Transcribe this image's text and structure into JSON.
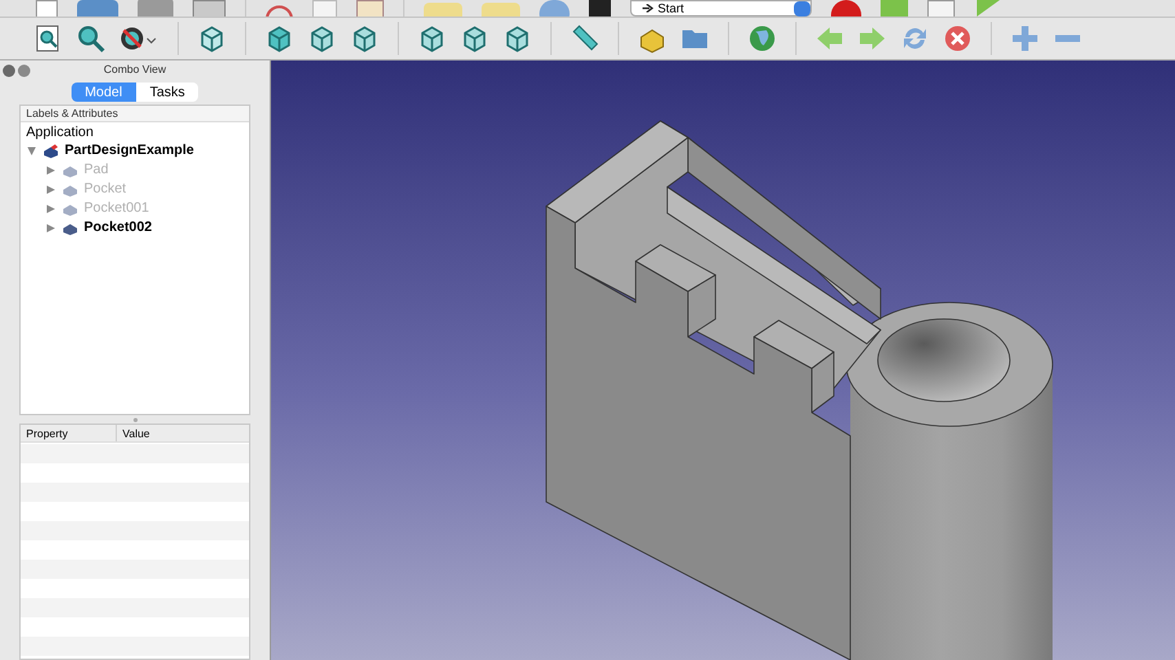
{
  "toolbar": {
    "workbench": "Start"
  },
  "combo_view": {
    "title": "Combo View",
    "tabs": [
      {
        "label": "Model",
        "selected": true
      },
      {
        "label": "Tasks",
        "selected": false
      }
    ],
    "tree": {
      "header": "Labels & Attributes",
      "root_label": "Application",
      "items": [
        {
          "label": "PartDesignExample",
          "expanded": true,
          "children": [
            {
              "label": "Pad",
              "visible": false
            },
            {
              "label": "Pocket",
              "visible": false
            },
            {
              "label": "Pocket001",
              "visible": false
            },
            {
              "label": "Pocket002",
              "visible": true
            }
          ]
        }
      ]
    },
    "properties": {
      "columns": [
        "Property",
        "Value"
      ]
    }
  }
}
